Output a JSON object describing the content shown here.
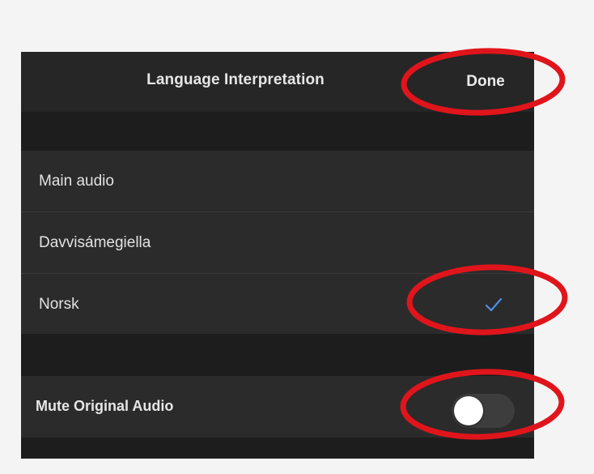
{
  "header": {
    "title": "Language Interpretation",
    "done_label": "Done"
  },
  "languages": [
    {
      "label": "Main audio",
      "selected": false
    },
    {
      "label": "Davvisámegiella",
      "selected": false
    },
    {
      "label": "Norsk",
      "selected": true
    }
  ],
  "mute_original_audio": {
    "label": "Mute Original Audio",
    "on": false
  },
  "colors": {
    "background": "#232323",
    "checkmark": "#4a90e2",
    "annotation": "#e0151b"
  },
  "icons": {
    "selected_marker": "checkmark-icon"
  }
}
